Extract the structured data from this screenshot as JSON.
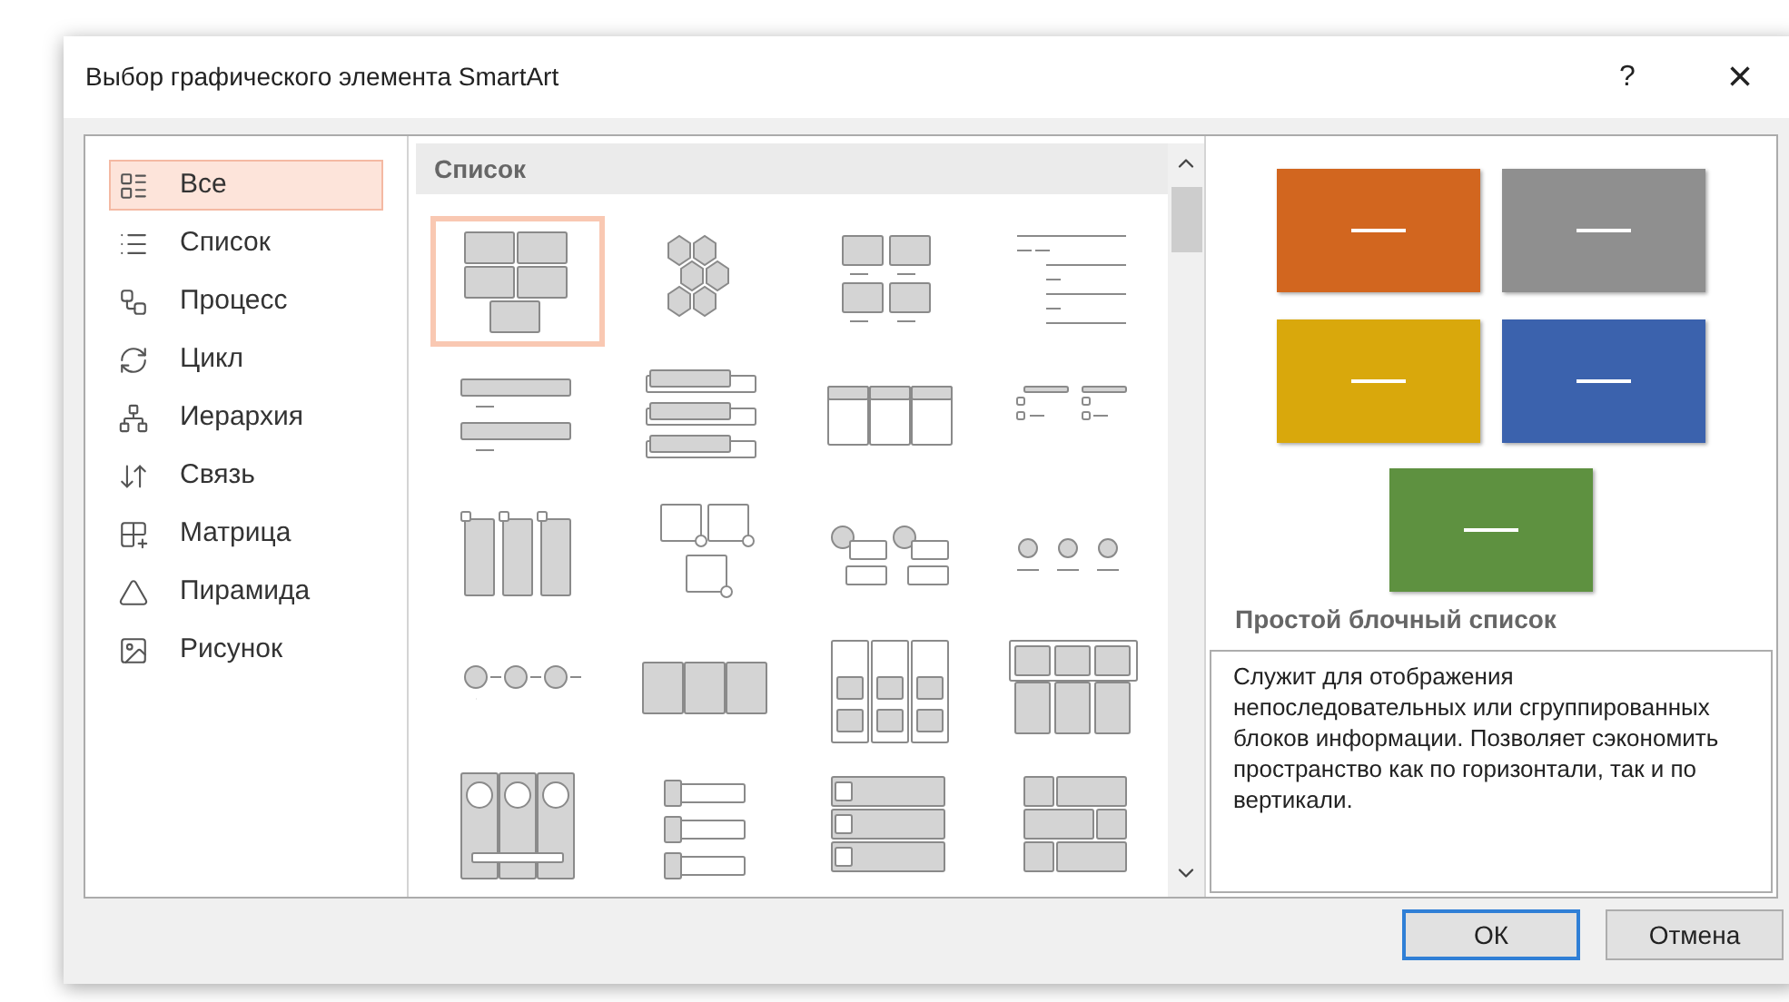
{
  "window": {
    "title": "Выбор графического элемента SmartArt",
    "help": "?",
    "close": "×"
  },
  "categories": [
    {
      "label": "Все",
      "selected": true
    },
    {
      "label": "Список",
      "selected": false
    },
    {
      "label": "Процесс",
      "selected": false
    },
    {
      "label": "Цикл",
      "selected": false
    },
    {
      "label": "Иерархия",
      "selected": false
    },
    {
      "label": "Связь",
      "selected": false
    },
    {
      "label": "Матрица",
      "selected": false
    },
    {
      "label": "Пирамида",
      "selected": false
    },
    {
      "label": "Рисунок",
      "selected": false
    }
  ],
  "gallery": {
    "heading": "Список",
    "items": [
      {
        "selected": true
      },
      {
        "selected": false
      },
      {
        "selected": false
      },
      {
        "selected": false
      },
      {
        "selected": false
      },
      {
        "selected": false
      },
      {
        "selected": false
      },
      {
        "selected": false
      },
      {
        "selected": false
      },
      {
        "selected": false
      },
      {
        "selected": false
      },
      {
        "selected": false
      },
      {
        "selected": false
      },
      {
        "selected": false
      },
      {
        "selected": false
      },
      {
        "selected": false
      },
      {
        "selected": false
      },
      {
        "selected": false
      },
      {
        "selected": false
      },
      {
        "selected": false
      }
    ]
  },
  "preview": {
    "blocks": [
      {
        "color": "#d2661f"
      },
      {
        "color": "#8f8f8f"
      },
      {
        "color": "#d9a80c"
      },
      {
        "color": "#3b62ad"
      },
      {
        "color": "#5e9140"
      }
    ],
    "title": "Простой блочный список",
    "description": "Служит для отображения непоследовательных или сгруппированных блоков информации. Позволяет сэкономить пространство как по горизонтали, так и по вертикали."
  },
  "buttons": [
    {
      "label": "ОК",
      "default": true
    },
    {
      "label": "Отмена",
      "default": false
    }
  ]
}
